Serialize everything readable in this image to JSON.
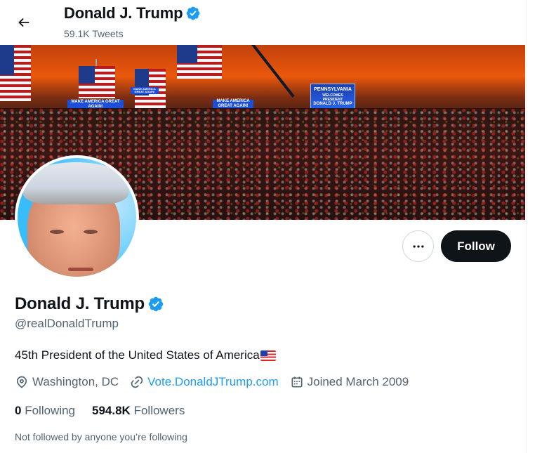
{
  "header": {
    "name": "Donald J. Trump",
    "tweet_count": "59.1K Tweets"
  },
  "banner": {
    "signs": [
      "MAKE AMERICA GREAT AGAIN!",
      "MAKE AMERICA GREAT AGAIN!",
      "MAKE AMERICA GREAT AGAIN!"
    ],
    "big_sign_lines": [
      "PENNSYLVANIA",
      "WELCOMES",
      "PRESIDENT",
      "DONALD J. TRUMP"
    ]
  },
  "actions": {
    "more_icon": "more-horizontal-icon",
    "follow_label": "Follow"
  },
  "profile": {
    "name": "Donald J. Trump",
    "handle": "@realDonaldTrump",
    "bio": "45th President of the United States of America",
    "location": "Washington, DC",
    "website": "Vote.DonaldJTrump.com",
    "joined": "Joined March 2009",
    "following_count": "0",
    "following_label": "Following",
    "followers_count": "594.8K",
    "followers_label": "Followers",
    "not_followed_text": "Not followed by anyone you’re following"
  },
  "colors": {
    "accent": "#1d9bf0",
    "text_primary": "#0f1419",
    "text_secondary": "#536471",
    "follow_button_bg": "#0f1419"
  }
}
